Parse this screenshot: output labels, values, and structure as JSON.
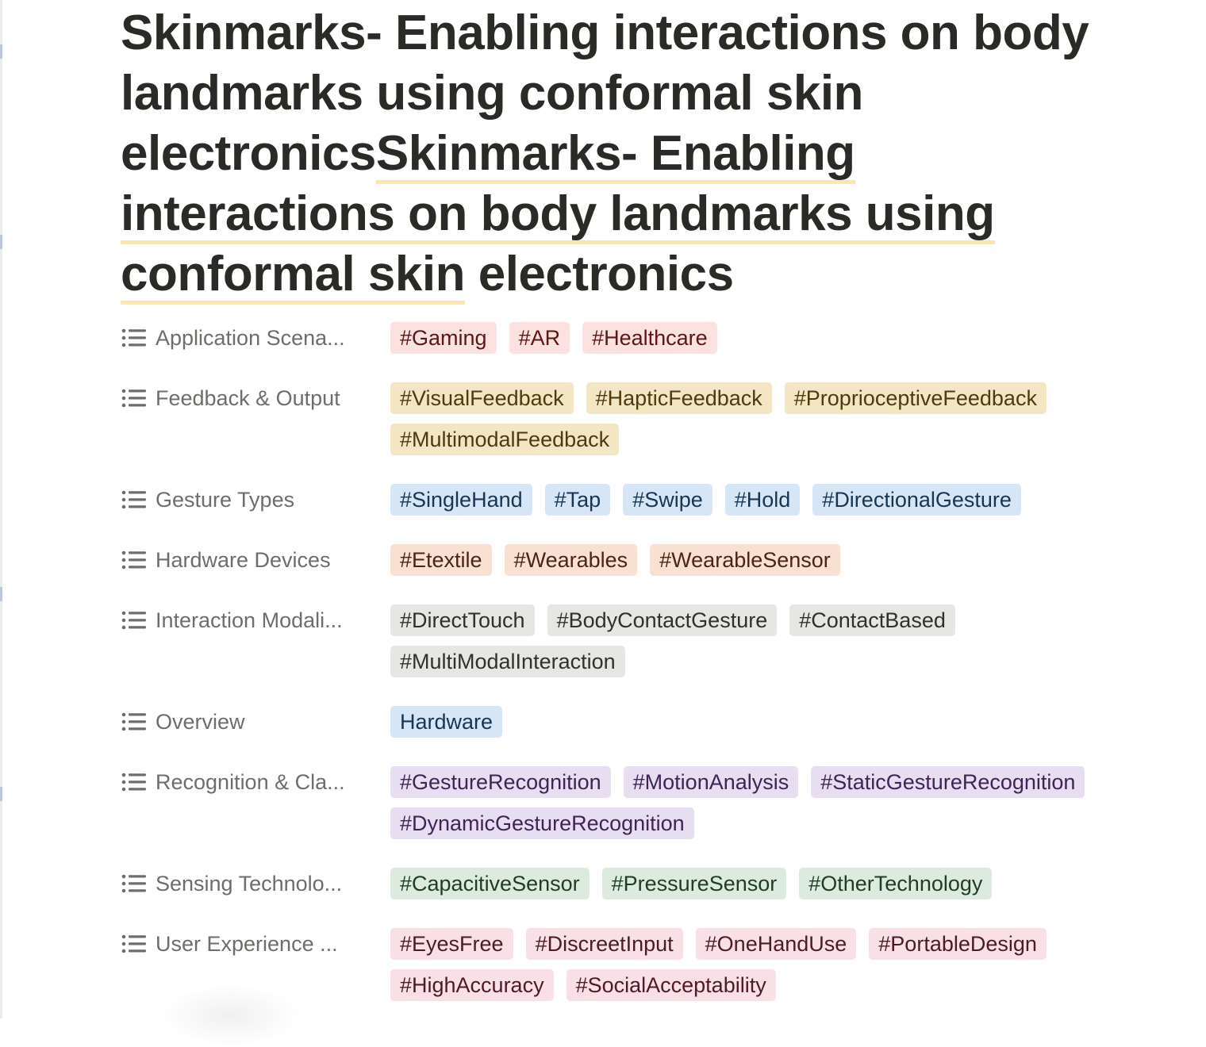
{
  "page": {
    "title_plain": "Skinmarks- Enabling interactions on body landmarks using conformal skin electronics",
    "title_linked": "Skinmarks- Enabling interactions on body landmarks using conformal skin",
    "title_tail": " electronics"
  },
  "properties": [
    {
      "label": "Application Scena...",
      "icon": "list-icon",
      "tags": [
        {
          "text": "#Gaming",
          "color": "red"
        },
        {
          "text": "#AR",
          "color": "red"
        },
        {
          "text": "#Healthcare",
          "color": "red"
        }
      ]
    },
    {
      "label": "Feedback & Output",
      "icon": "list-icon",
      "tags": [
        {
          "text": "#VisualFeedback",
          "color": "yellow"
        },
        {
          "text": "#HapticFeedback",
          "color": "yellow"
        },
        {
          "text": "#ProprioceptiveFeedback",
          "color": "yellow"
        },
        {
          "text": "#MultimodalFeedback",
          "color": "yellow"
        }
      ]
    },
    {
      "label": "Gesture Types",
      "icon": "list-icon",
      "tags": [
        {
          "text": "#SingleHand",
          "color": "blue"
        },
        {
          "text": "#Tap",
          "color": "blue"
        },
        {
          "text": "#Swipe",
          "color": "blue"
        },
        {
          "text": "#Hold",
          "color": "blue"
        },
        {
          "text": "#DirectionalGesture",
          "color": "blue"
        }
      ]
    },
    {
      "label": "Hardware Devices",
      "icon": "list-icon",
      "tags": [
        {
          "text": "#Etextile",
          "color": "orange"
        },
        {
          "text": "#Wearables",
          "color": "orange"
        },
        {
          "text": "#WearableSensor",
          "color": "orange"
        }
      ]
    },
    {
      "label": "Interaction Modali...",
      "icon": "list-icon",
      "tags": [
        {
          "text": "#DirectTouch",
          "color": "gray"
        },
        {
          "text": "#BodyContactGesture",
          "color": "gray"
        },
        {
          "text": "#ContactBased",
          "color": "gray"
        },
        {
          "text": "#MultiModalInteraction",
          "color": "gray"
        }
      ]
    },
    {
      "label": "Overview",
      "icon": "list-icon",
      "tags": [
        {
          "text": "Hardware",
          "color": "blue"
        }
      ]
    },
    {
      "label": "Recognition & Cla...",
      "icon": "list-icon",
      "tags": [
        {
          "text": "#GestureRecognition",
          "color": "purple"
        },
        {
          "text": "#MotionAnalysis",
          "color": "purple"
        },
        {
          "text": "#StaticGestureRecognition",
          "color": "purple"
        },
        {
          "text": "#DynamicGestureRecognition",
          "color": "purple"
        }
      ]
    },
    {
      "label": "Sensing Technolo...",
      "icon": "list-icon",
      "tags": [
        {
          "text": "#CapacitiveSensor",
          "color": "green"
        },
        {
          "text": "#PressureSensor",
          "color": "green"
        },
        {
          "text": "#OtherTechnology",
          "color": "green"
        }
      ]
    },
    {
      "label": "User Experience ...",
      "icon": "list-icon",
      "tags": [
        {
          "text": "#EyesFree",
          "color": "pink"
        },
        {
          "text": "#DiscreetInput",
          "color": "pink"
        },
        {
          "text": "#OneHandUse",
          "color": "pink"
        },
        {
          "text": "#PortableDesign",
          "color": "pink"
        },
        {
          "text": "#HighAccuracy",
          "color": "pink"
        },
        {
          "text": "#SocialAcceptability",
          "color": "pink"
        }
      ]
    }
  ]
}
